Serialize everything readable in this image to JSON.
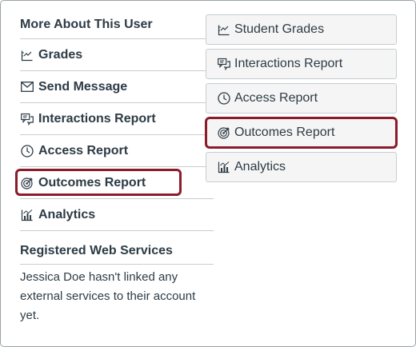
{
  "left": {
    "heading": "More About This User",
    "items": [
      {
        "label": "Grades",
        "icon": "gradebook-icon"
      },
      {
        "label": "Send Message",
        "icon": "envelope-icon"
      },
      {
        "label": "Interactions Report",
        "icon": "chat-bubbles-icon"
      },
      {
        "label": "Access Report",
        "icon": "clock-icon"
      },
      {
        "label": "Outcomes Report",
        "icon": "target-icon",
        "highlighted": true
      },
      {
        "label": "Analytics",
        "icon": "analytics-chart-icon"
      }
    ],
    "services_title": "Registered Web Services",
    "services_body": "Jessica Doe hasn't linked any external services to their account yet."
  },
  "right": {
    "buttons": [
      {
        "label": "Student Grades",
        "icon": "gradebook-icon"
      },
      {
        "label": "Interactions Report",
        "icon": "chat-bubbles-icon"
      },
      {
        "label": "Access Report",
        "icon": "clock-icon"
      },
      {
        "label": "Outcomes Report",
        "icon": "target-icon",
        "highlighted": true
      },
      {
        "label": "Analytics",
        "icon": "analytics-chart-icon"
      }
    ]
  },
  "colors": {
    "highlight": "#8b1c2b",
    "text": "#2d3b45",
    "border": "#c7cdd1",
    "button_bg": "#f5f5f5"
  }
}
